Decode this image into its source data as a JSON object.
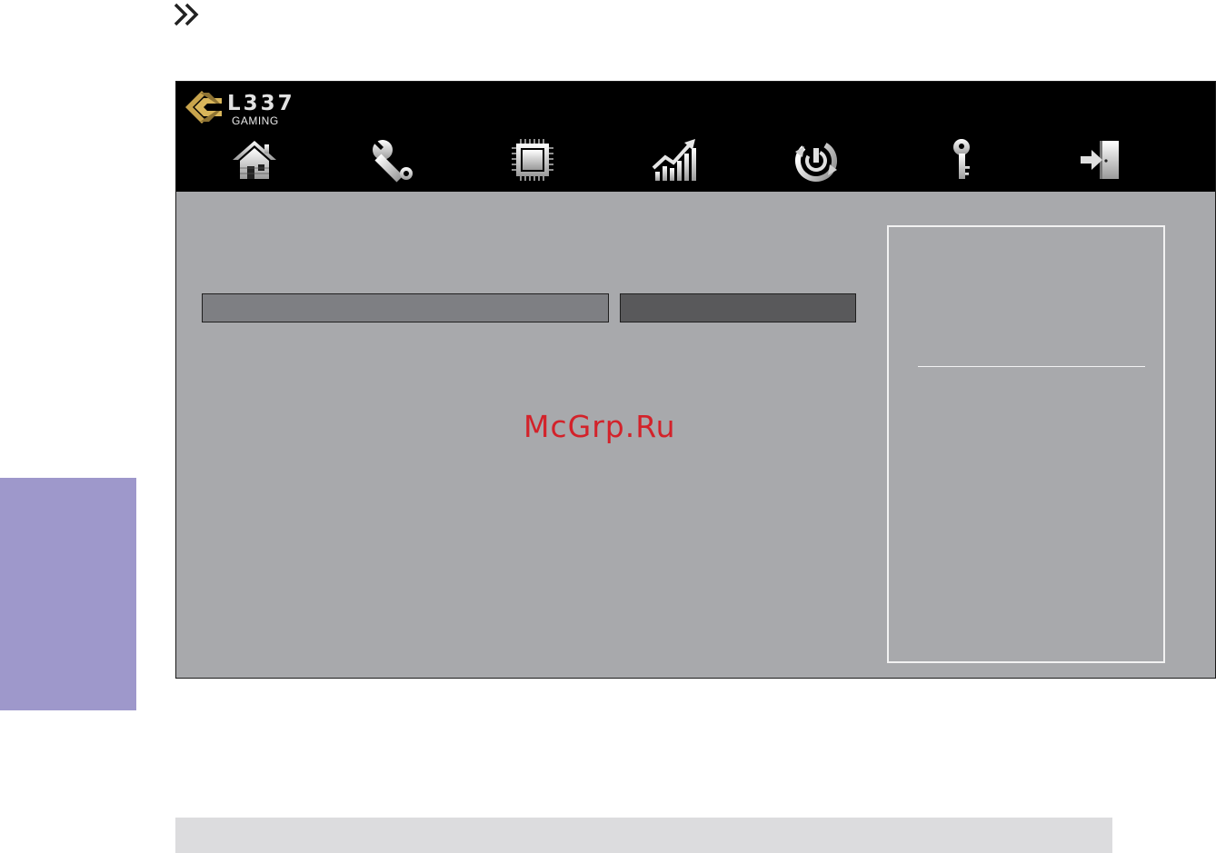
{
  "brand": {
    "logo_text": "L337",
    "logo_subtext": "GAMING"
  },
  "nav_items": [
    {
      "id": "main",
      "icon": "home-icon"
    },
    {
      "id": "advanced",
      "icon": "wrench-icon"
    },
    {
      "id": "chipset",
      "icon": "chip-icon"
    },
    {
      "id": "overclock",
      "icon": "chart-icon"
    },
    {
      "id": "power",
      "icon": "power-icon"
    },
    {
      "id": "security",
      "icon": "key-icon"
    },
    {
      "id": "exit",
      "icon": "exit-icon"
    }
  ],
  "watermark": "McGrp.Ru",
  "colors": {
    "header_bg": "#000000",
    "panel_bg": "#a8a9ac",
    "side_tab": "#9e98cb",
    "watermark": "#d3222a",
    "logo_gold": "#c8a44c"
  }
}
